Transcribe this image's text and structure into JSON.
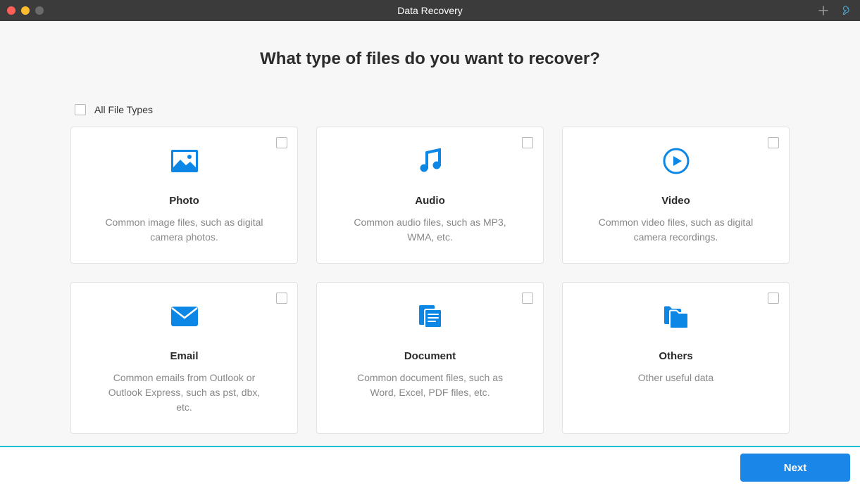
{
  "titlebar": {
    "title": "Data Recovery"
  },
  "heading": "What type of files do you want to recover?",
  "allTypes": {
    "label": "All File Types"
  },
  "cards": {
    "photo": {
      "title": "Photo",
      "desc": "Common image files, such as digital camera photos."
    },
    "audio": {
      "title": "Audio",
      "desc": "Common audio files, such as MP3, WMA, etc."
    },
    "video": {
      "title": "Video",
      "desc": "Common video files, such as digital camera recordings."
    },
    "email": {
      "title": "Email",
      "desc": "Common emails from Outlook or Outlook Express, such as pst, dbx, etc."
    },
    "document": {
      "title": "Document",
      "desc": "Common document files, such as Word, Excel, PDF files, etc."
    },
    "others": {
      "title": "Others",
      "desc": "Other useful data"
    }
  },
  "footer": {
    "nextLabel": "Next"
  },
  "colors": {
    "accent": "#1a87e8",
    "iconBlue": "#0d87e6",
    "footerBorder": "#18c1d4"
  }
}
